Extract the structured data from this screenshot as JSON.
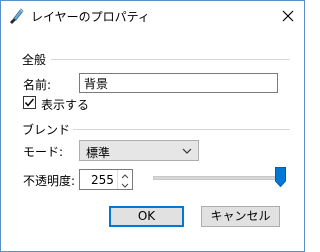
{
  "window": {
    "title": "レイヤーのプロパティ",
    "app_icon": "brush-icon",
    "close_icon": "close-icon"
  },
  "general": {
    "heading": "全般",
    "name_label": "名前:",
    "name_value": "背景",
    "visible_label": "表示する",
    "visible_checked": true
  },
  "blend": {
    "heading": "ブレンド",
    "mode_label": "モード:",
    "mode_value": "標準",
    "opacity_label": "不透明度:",
    "opacity_value": "255",
    "opacity_max": 255
  },
  "buttons": {
    "ok": "OK",
    "cancel": "キャンセル"
  },
  "colors": {
    "accent": "#0078d7",
    "border": "#5a8fc9"
  }
}
